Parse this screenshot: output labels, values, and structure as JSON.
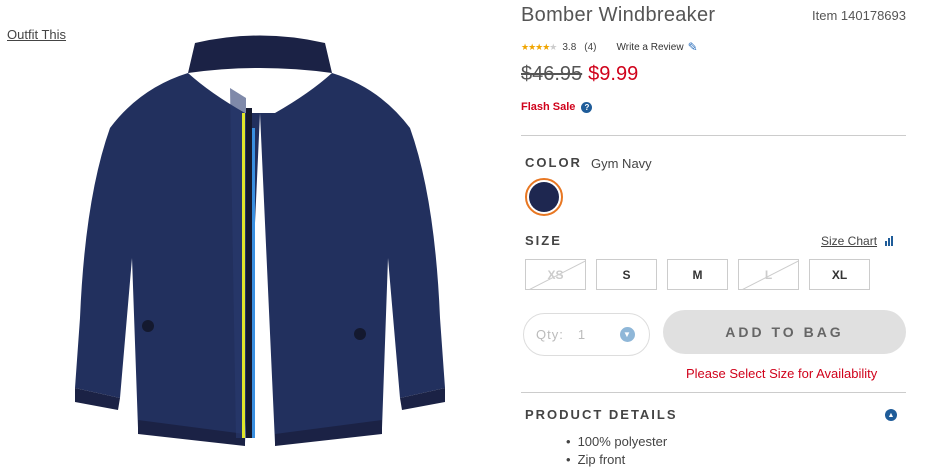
{
  "outfit_link": "Outfit This",
  "product": {
    "title": "Bomber Windbreaker",
    "item_number": "Item 140178693",
    "rating": 3.8,
    "rating_text": "3.8",
    "review_count": "(4)",
    "write_review": "Write a Review",
    "old_price": "$46.95",
    "sale_price": "$9.99",
    "flash_sale": "Flash Sale",
    "help_glyph": "?"
  },
  "color": {
    "label": "COLOR",
    "value": "Gym Navy",
    "swatch_hex": "#1e2750"
  },
  "size": {
    "label": "SIZE",
    "size_chart": "Size Chart",
    "options": [
      {
        "label": "XS",
        "available": false
      },
      {
        "label": "S",
        "available": true
      },
      {
        "label": "M",
        "available": true
      },
      {
        "label": "L",
        "available": false
      },
      {
        "label": "XL",
        "available": true
      }
    ]
  },
  "quantity": {
    "label": "Qty:",
    "value": "1"
  },
  "add_to_bag": "ADD TO BAG",
  "availability_message": "Please Select Size for Availability",
  "details": {
    "title": "PRODUCT DETAILS",
    "items": [
      "100% polyester",
      "Zip front"
    ]
  },
  "colors": {
    "accent": "#d0021b",
    "link_blue": "#1f5c99",
    "swatch_ring": "#e87722",
    "star": "#f0a500"
  },
  "icons": {
    "edit": "pencil-icon",
    "help": "help-icon",
    "size_chart": "bar-chart-icon",
    "qty_dropdown": "chevron-down-icon",
    "collapse": "chevron-up-icon"
  }
}
